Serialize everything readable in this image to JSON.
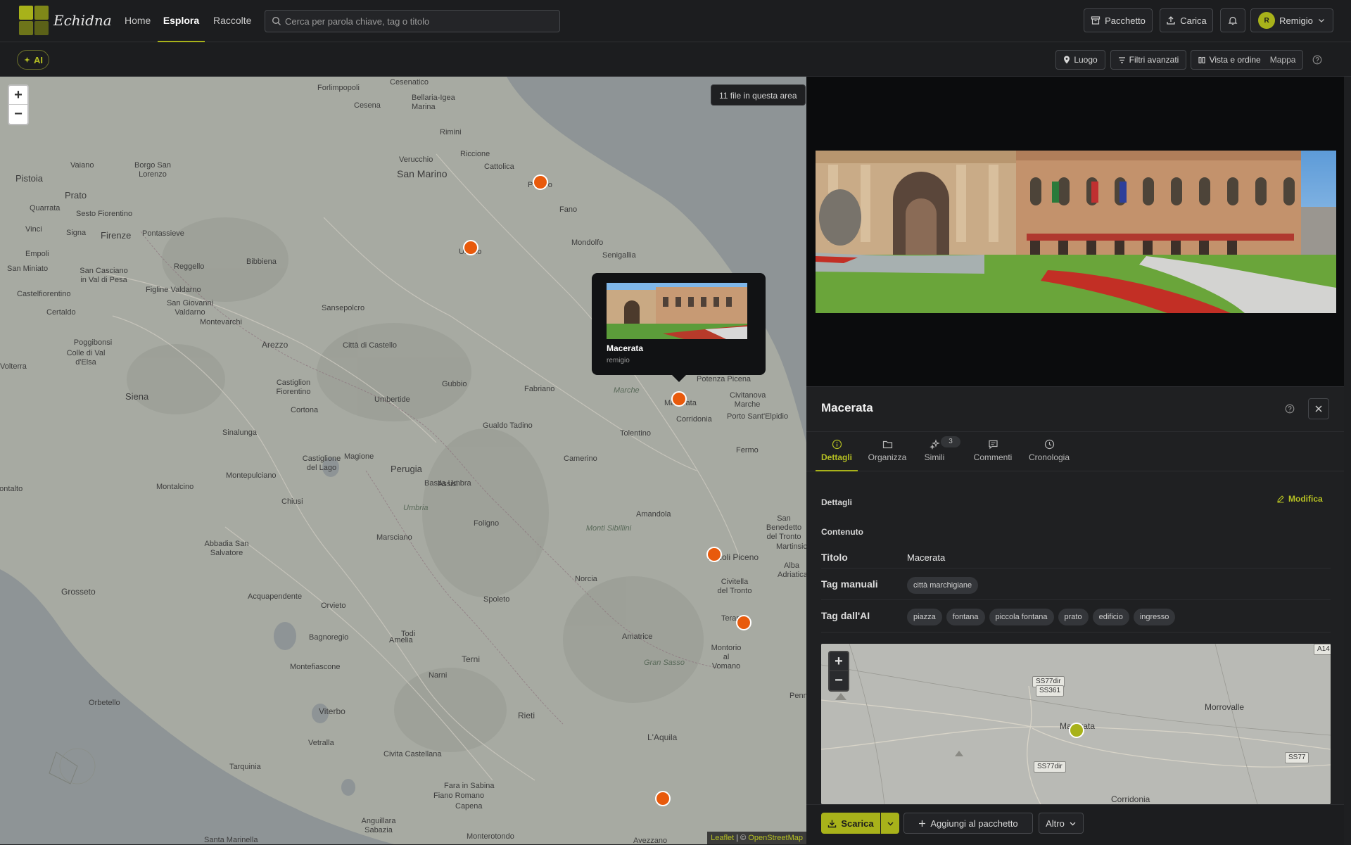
{
  "brand": {
    "name": "Echidna",
    "accent": "#a8b21a"
  },
  "nav": {
    "tabs": [
      {
        "label": "Home"
      },
      {
        "label": "Esplora",
        "active": true
      },
      {
        "label": "Raccolte"
      }
    ]
  },
  "search": {
    "placeholder": "Cerca per parola chiave, tag o titolo",
    "value": ""
  },
  "topbar": {
    "package_label": "Pacchetto",
    "upload_label": "Carica",
    "user_initial": "R",
    "user_name": "Remigio"
  },
  "subbar": {
    "ai_label": "AI",
    "place_label": "Luogo",
    "filters_label": "Filtri avanzati",
    "view_label": "Vista e ordine",
    "view_value": "Mappa"
  },
  "map": {
    "count_badge": "11 file in questa area",
    "attribution_leaflet": "Leaflet",
    "attribution_sep": " | © ",
    "attribution_osm": "OpenStreetMap",
    "marker_color": "#e85a0c",
    "places": [
      "Forlimpopoli",
      "Cesenatico",
      "Cesena",
      "Bellaria-Igea Marina",
      "Rimini",
      "Riccione",
      "Verucchio",
      "Cattolica",
      "San Marino",
      "Pesaro",
      "Fano",
      "Urbino",
      "Mondolfo",
      "Senigallia",
      "Vaiano",
      "Borgo San Lorenzo",
      "Pistoia",
      "Prato",
      "Quarrata",
      "Sesto Fiorentino",
      "Vinci",
      "Signa",
      "Firenze",
      "Pontassieve",
      "Empoli",
      "Bibbiena",
      "Reggello",
      "San Miniato",
      "San Casciano in Val di Pesa",
      "Castelfiorentino",
      "Figline Valdarno",
      "San Giovanni Valdarno",
      "Montevarchi",
      "Sansepolcro",
      "Certaldo",
      "Poggibonsi",
      "Colle di Val d'Elsa",
      "Arezzo",
      "Città di Castello",
      "Volterra",
      "Castiglion Fiorentino",
      "Gubbio",
      "Fabriano",
      "Siena",
      "Umbertide",
      "Cortona",
      "Montepulciano",
      "Sinalunga",
      "Castiglione del Lago",
      "Magione",
      "Perugia",
      "Gualdo Tadino",
      "Bastia Umbra",
      "Marche",
      "Macerata",
      "Potenza Picena",
      "Civitanova Marche",
      "Porto Sant'Elpidio",
      "Corridonia",
      "Tolentino",
      "Fermo",
      "Camerino",
      "Foligno",
      "Montalcino",
      "Chiusi",
      "Assisi",
      "Umbria",
      "Amandola",
      "Montalto",
      "Marsciano",
      "Abbadia San Salvatore",
      "Ascoli Piceno",
      "San Benedetto del Tronto",
      "Martinsicuro",
      "Alba Adriatica",
      "Grosseto",
      "Acquapendente",
      "Orvieto",
      "Spoleto",
      "Norcia",
      "Civitella del Tronto",
      "Teramo",
      "Bagnoregio",
      "Todi",
      "Montorio al Vomano",
      "Amelia",
      "Amatrice",
      "Montefiascone",
      "Narni",
      "Terni",
      "Orbetello",
      "Viterbo",
      "Rieti",
      "Vetralla",
      "L'Aquila",
      "Tarquinia",
      "Civita Castellana",
      "Fara in Sabina",
      "Fiano Romano",
      "Capena",
      "Anguillara Sabazia",
      "Santa Marinella",
      "Monterotondo",
      "Avezzano",
      "Penne",
      "Monti Sibillini",
      "Gran Sasso"
    ],
    "popup": {
      "title": "Macerata",
      "user": "remigio"
    }
  },
  "panel": {
    "title": "Macerata",
    "tabs": [
      {
        "label": "Dettagli",
        "active": true
      },
      {
        "label": "Organizza"
      },
      {
        "label": "Simili",
        "badge": "3"
      },
      {
        "label": "Commenti"
      },
      {
        "label": "Cronologia"
      }
    ],
    "section_details": "Dettagli",
    "edit_label": "Modifica",
    "section_content": "Contenuto",
    "fields": {
      "title_label": "Titolo",
      "title_value": "Macerata",
      "manual_tags_label": "Tag manuali",
      "manual_tags": [
        "città marchigiane"
      ],
      "ai_tags_label": "Tag dall'AI",
      "ai_tags": [
        "piazza",
        "fontana",
        "piccola fontana",
        "prato",
        "edificio",
        "ingresso"
      ]
    },
    "minimap": {
      "labels": [
        "SS77dir",
        "SS361",
        "Macerata",
        "Morrovalle",
        "SS77",
        "SS77dir",
        "Corridonia",
        "A14"
      ],
      "marker_color": "#a8b21a"
    },
    "footer": {
      "download_label": "Scarica",
      "add_to_package_label": "Aggiungi al pacchetto",
      "more_label": "Altro"
    }
  }
}
